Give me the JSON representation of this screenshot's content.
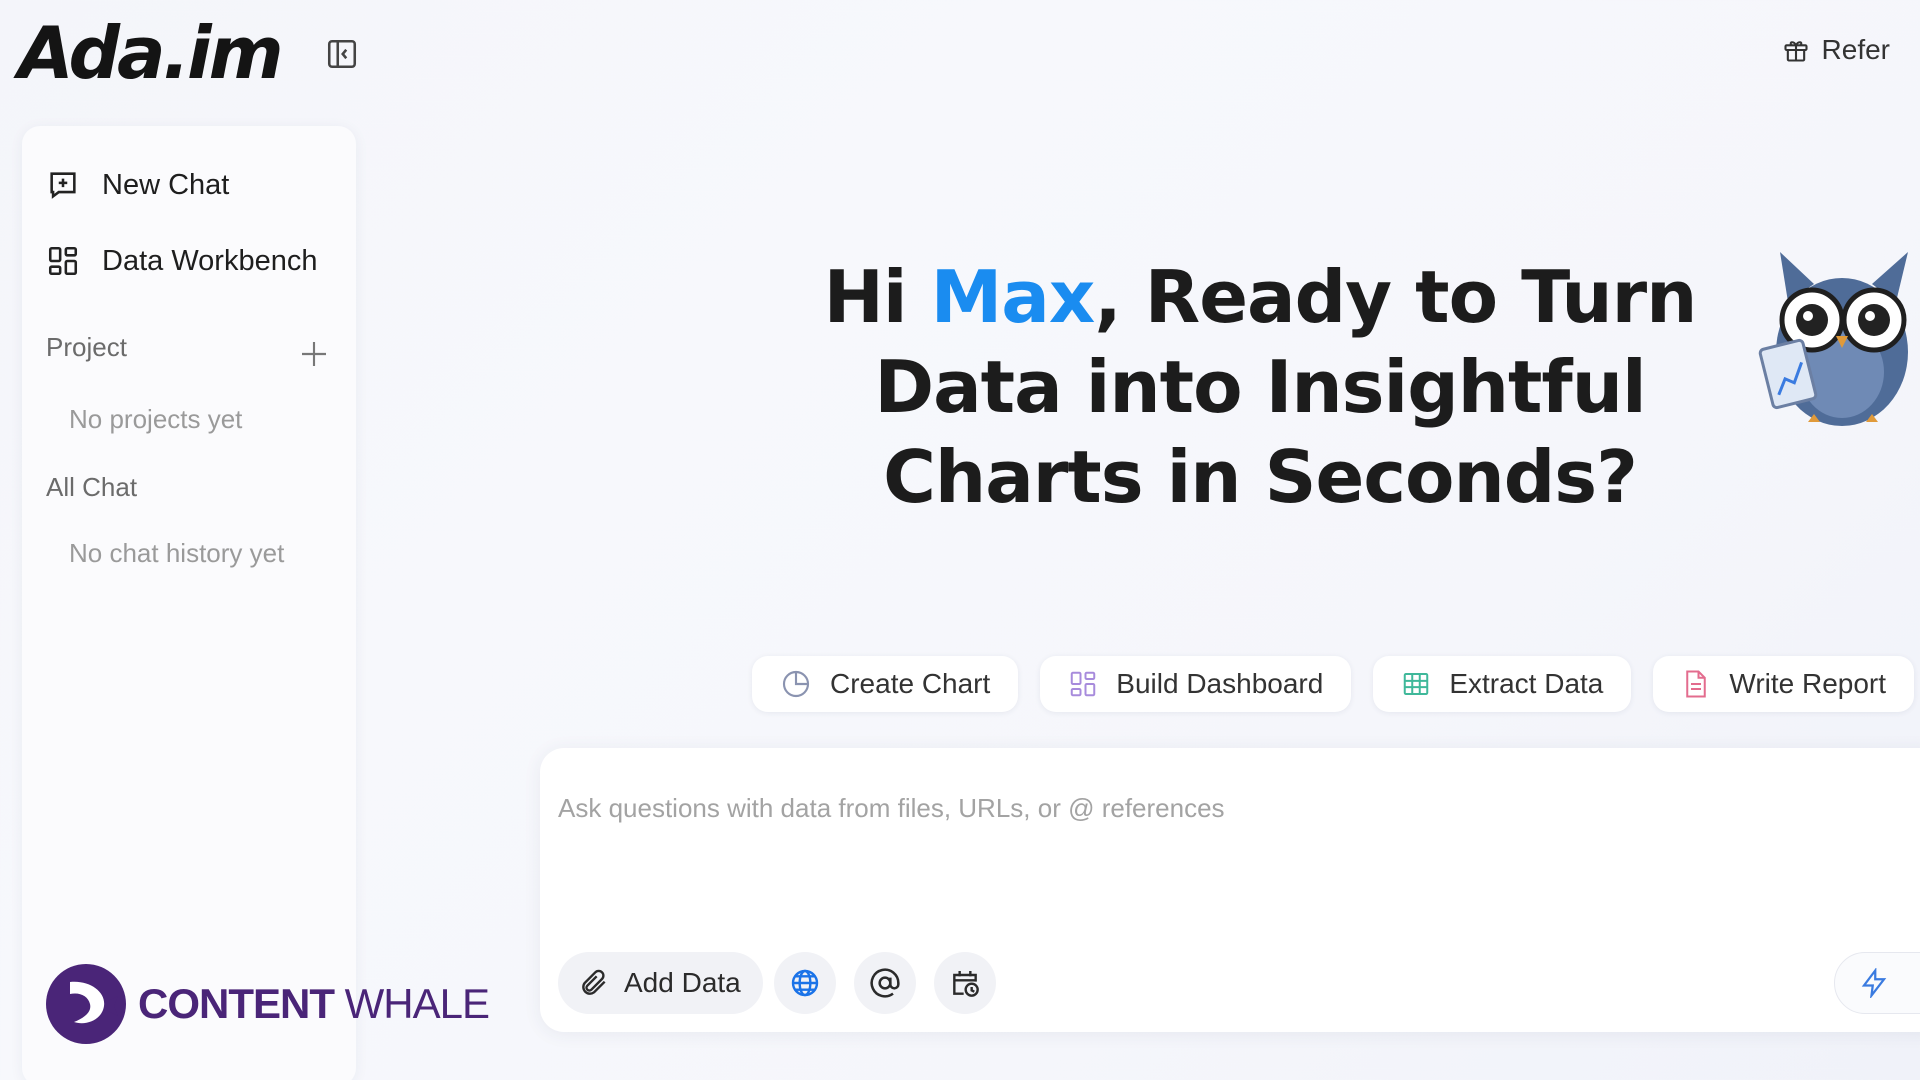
{
  "app": {
    "logo_text": "Ada.im",
    "brand_color": "#1f6fe6"
  },
  "header": {
    "refer_label": "Refer",
    "refer_icon": "gift-icon",
    "collapse_icon": "sidebar-collapse-icon"
  },
  "sidebar": {
    "items": [
      {
        "label": "New Chat",
        "icon": "new-chat-icon"
      },
      {
        "label": "Data Workbench",
        "icon": "grid-icon"
      }
    ],
    "project": {
      "title": "Project",
      "empty": "No projects yet",
      "add_icon": "plus-icon"
    },
    "all_chat": {
      "title": "All Chat",
      "empty": "No chat history yet"
    }
  },
  "hero": {
    "greeting": "Hi ",
    "user_name": "Max",
    "line1_rest": ", Ready to Turn",
    "line2": "Data into Insightful",
    "line3": "Charts in Seconds?",
    "name_color": "#1a8cf0"
  },
  "actions": [
    {
      "label": "Create Chart",
      "icon": "pie-chart-icon"
    },
    {
      "label": "Build Dashboard",
      "icon": "dashboard-icon"
    },
    {
      "label": "Extract Data",
      "icon": "table-icon"
    },
    {
      "label": "Write Report",
      "icon": "document-icon"
    }
  ],
  "composer": {
    "placeholder": "Ask questions with data from files, URLs, or @ references",
    "value": "",
    "add_data_label": "Add Data",
    "tools": [
      "globe-icon",
      "at-icon",
      "calendar-clock-icon",
      "bolt-icon"
    ]
  },
  "watermark": {
    "text_bold": "CONTENT",
    "text_light": " WHALE",
    "color": "#4a2578"
  }
}
